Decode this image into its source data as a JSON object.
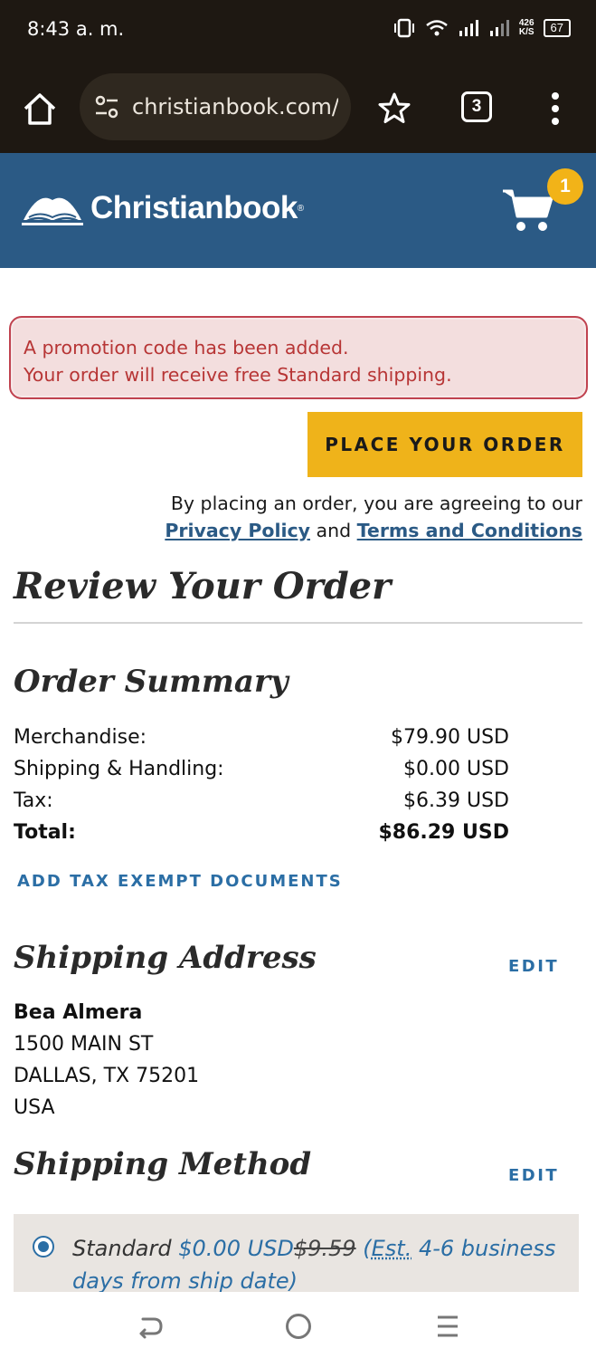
{
  "status_bar": {
    "time": "8:43 a. m.",
    "net_speed_value": "426",
    "net_speed_unit": "K/S",
    "battery": "67"
  },
  "browser": {
    "url": "christianbook.com/a",
    "tab_count": "3"
  },
  "site": {
    "logo_text": "Christianbook",
    "cart_count": "1"
  },
  "alert": {
    "line1": "A promotion code has been added.",
    "line2": "Your order will receive free Standard shipping."
  },
  "order_actions": {
    "place_order_label": "PLACE YOUR ORDER",
    "agreement_text": "By placing an order, you are agreeing to our",
    "privacy_link": "Privacy Policy",
    "and_text": "and",
    "terms_link": "Terms and Conditions"
  },
  "review": {
    "title": "Review Your Order"
  },
  "summary": {
    "title": "Order Summary",
    "rows": [
      {
        "label": "Merchandise:",
        "value": "$79.90 USD"
      },
      {
        "label": "Shipping & Handling:",
        "value": "$0.00 USD"
      },
      {
        "label": "Tax:",
        "value": "$6.39 USD"
      },
      {
        "label": "Total:",
        "value": "$86.29 USD"
      }
    ],
    "tax_exempt_link": "ADD TAX EXEMPT DOCUMENTS"
  },
  "shipping_address": {
    "title": "Shipping Address",
    "edit_label": "EDIT",
    "name": "Bea Almera",
    "street": "1500 MAIN ST",
    "city_state_zip": "DALLAS, TX 75201",
    "country": "USA"
  },
  "shipping_method": {
    "title": "Shipping Method",
    "edit_label": "EDIT",
    "option_name": "Standard",
    "price": "$0.00 USD",
    "old_price": "$9.59",
    "est_open": "(",
    "est_abbr": "Est.",
    "est_rest": "4-6 business days from ship date)"
  },
  "colors": {
    "header_blue": "#2b5a85",
    "accent_gold": "#efb31a",
    "link_blue": "#2b6ea5",
    "alert_red": "#b73535"
  }
}
